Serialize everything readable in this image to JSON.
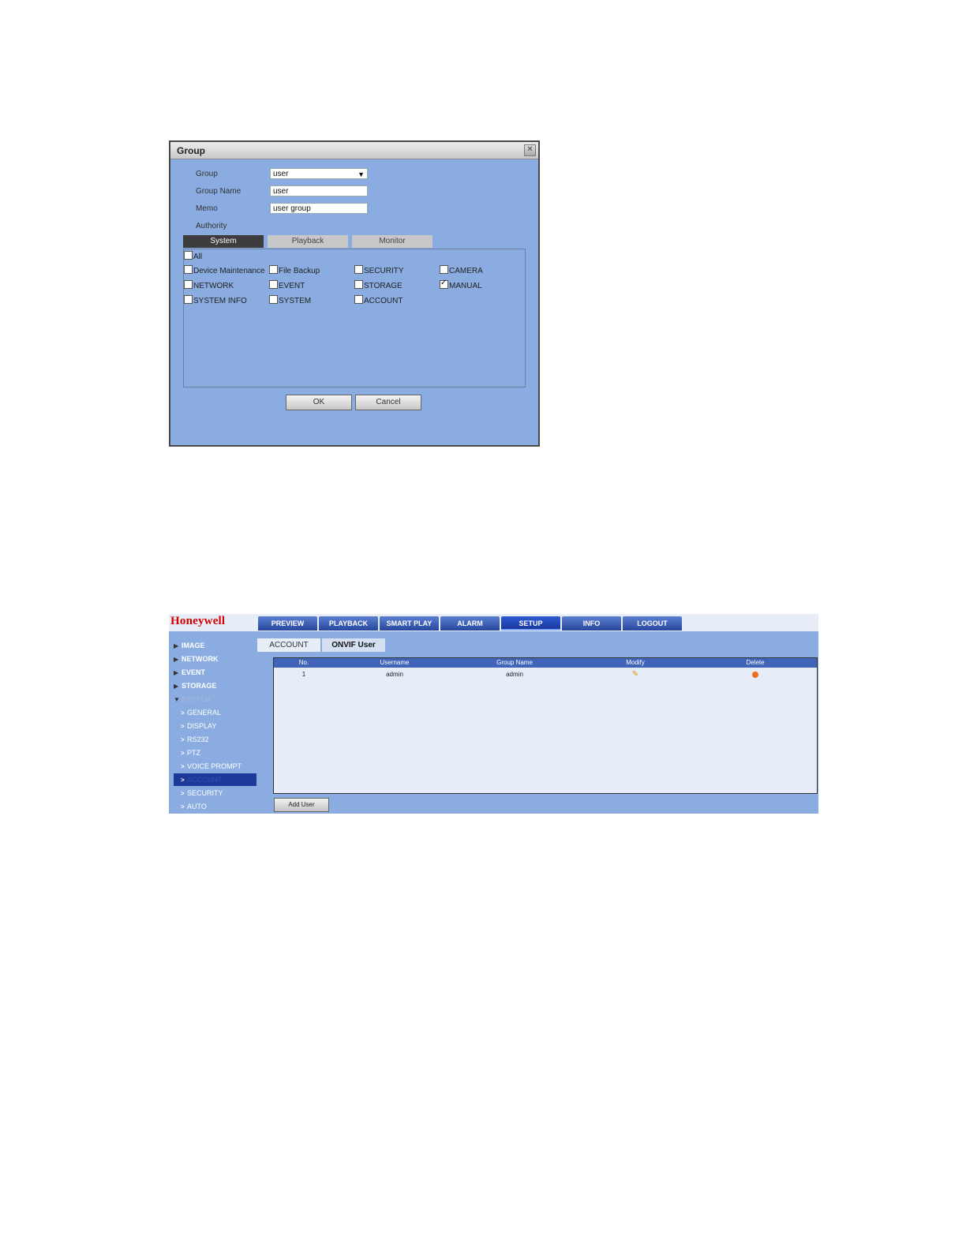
{
  "dialog": {
    "title": "Group",
    "close_label": "✕",
    "labels": {
      "group": "Group",
      "group_name": "Group Name",
      "memo": "Memo",
      "authority": "Authority"
    },
    "group_value": "user",
    "group_name_value": "user",
    "memo_value": "user group",
    "tabs": [
      "System",
      "Playback",
      "Monitor"
    ],
    "checkboxes": [
      {
        "label": "All",
        "checked": false
      },
      {
        "label": "Device Maintenance",
        "checked": false
      },
      {
        "label": "File Backup",
        "checked": false
      },
      {
        "label": "SECURITY",
        "checked": false
      },
      {
        "label": "CAMERA",
        "checked": false
      },
      {
        "label": "NETWORK",
        "checked": false
      },
      {
        "label": "EVENT",
        "checked": false
      },
      {
        "label": "STORAGE",
        "checked": false
      },
      {
        "label": "MANUAL",
        "checked": true
      },
      {
        "label": "SYSTEM INFO",
        "checked": false
      },
      {
        "label": "SYSTEM",
        "checked": false
      },
      {
        "label": "ACCOUNT",
        "checked": false
      }
    ],
    "ok_label": "OK",
    "cancel_label": "Cancel"
  },
  "app": {
    "logo": "Honeywell",
    "nav": [
      "PREVIEW",
      "PLAYBACK",
      "SMART PLAY",
      "ALARM",
      "SETUP",
      "INFO",
      "LOGOUT"
    ],
    "active_nav": "SETUP",
    "sidebar": {
      "main_items": [
        "IMAGE",
        "NETWORK",
        "EVENT",
        "STORAGE",
        "SYSTEM"
      ],
      "sub_items": [
        "GENERAL",
        "DISPLAY",
        "RS232",
        "PTZ",
        "VOICE PROMPT",
        "ACCOUNT",
        "SECURITY",
        "AUTO MAINTENANCE"
      ],
      "selected_sub": "ACCOUNT"
    },
    "content_tabs": [
      "ACCOUNT",
      "ONVIF User"
    ],
    "table": {
      "headers": [
        "No.",
        "Username",
        "Group Name",
        "Modify",
        "Delete"
      ],
      "rows": [
        {
          "no": "1",
          "username": "admin",
          "group_name": "admin"
        }
      ]
    },
    "add_user_label": "Add User"
  }
}
